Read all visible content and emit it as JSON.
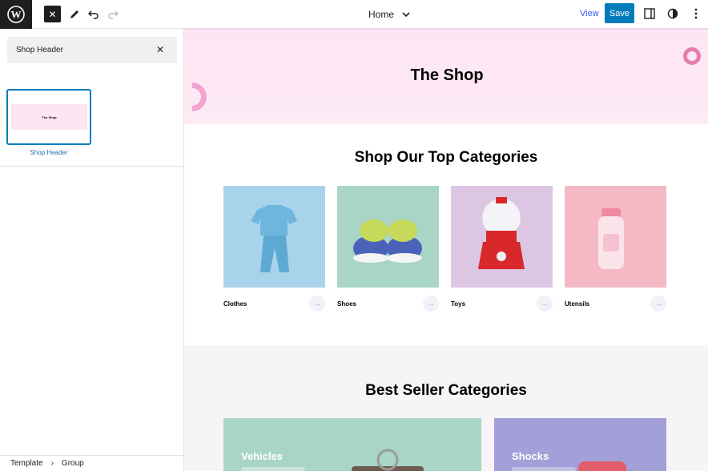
{
  "toolbar": {
    "document_title": "Home",
    "view_label": "View",
    "save_label": "Save"
  },
  "sidebar": {
    "search_value": "Shop Header",
    "pattern": {
      "preview_title": "The Shop",
      "label": "Shop Header"
    },
    "breadcrumb": [
      "Template",
      "Group"
    ]
  },
  "canvas": {
    "hero_title": "The Shop",
    "top_categories": {
      "title": "Shop Our Top Categories",
      "items": [
        {
          "name": "Clothes",
          "color": "#a8d3ea"
        },
        {
          "name": "Shoes",
          "color": "#a9d5c6"
        },
        {
          "name": "Toys",
          "color": "#dcc6e3"
        },
        {
          "name": "Utensils",
          "color": "#f4b9c5"
        }
      ]
    },
    "best_seller": {
      "title": "Best Seller Categories",
      "items": [
        {
          "name": "Vehicles",
          "color": "#a9d5c6"
        },
        {
          "name": "Shocks",
          "color": "#a39fd9"
        }
      ]
    }
  },
  "colors": {
    "accent": "#007cba",
    "hero_bg": "#fde6f3",
    "topbar_dark": "#1e1e1e"
  }
}
